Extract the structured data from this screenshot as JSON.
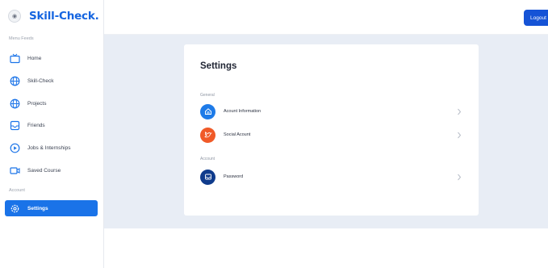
{
  "brand": {
    "name": "Skill-Check."
  },
  "sidebar": {
    "menu_label": "Menu Feeds",
    "items": [
      {
        "label": "Home",
        "icon": "tv-icon"
      },
      {
        "label": "Skill-Check",
        "icon": "globe-icon"
      },
      {
        "label": "Projects",
        "icon": "globe-icon"
      },
      {
        "label": "Friends",
        "icon": "inbox-icon"
      },
      {
        "label": "Jobs & Internships",
        "icon": "play-circle-icon"
      },
      {
        "label": "Saved Course",
        "icon": "video-icon"
      }
    ],
    "account_label": "Account",
    "settings_label": "Settings"
  },
  "header": {
    "logout_label": "Logout"
  },
  "settings": {
    "title": "Settings",
    "general_label": "General",
    "account_label": "Account",
    "rows": [
      {
        "label": "Acount Information",
        "icon": "home-icon",
        "color": "#1e7be8"
      },
      {
        "label": "Social Acount",
        "icon": "twitter-icon",
        "color": "#f05a28"
      },
      {
        "label": "Password",
        "icon": "inbox-icon",
        "color": "#0f3b8c"
      }
    ]
  },
  "colors": {
    "accent": "#1a73e8",
    "brand": "#1565e0",
    "background": "#e8edf5"
  }
}
